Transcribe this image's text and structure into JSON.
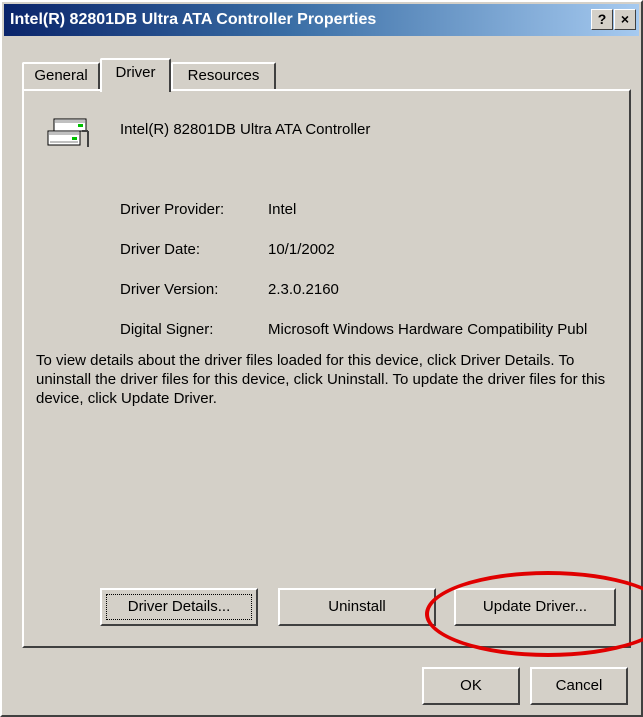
{
  "window": {
    "title": "Intel(R) 82801DB Ultra ATA Controller Properties",
    "help_button": "?",
    "close_button": "×"
  },
  "tabs": [
    {
      "label": "General"
    },
    {
      "label": "Driver",
      "selected": true
    },
    {
      "label": "Resources"
    }
  ],
  "device": {
    "name": "Intel(R) 82801DB Ultra ATA Controller",
    "icon": "ide-controller-icon"
  },
  "driver_info": [
    {
      "label": "Driver Provider:",
      "value": "Intel"
    },
    {
      "label": "Driver Date:",
      "value": "10/1/2002"
    },
    {
      "label": "Driver Version:",
      "value": "2.3.0.2160"
    },
    {
      "label": "Digital Signer:",
      "value": "Microsoft Windows Hardware Compatibility Publ"
    }
  ],
  "description": "To view details about the driver files loaded for this device, click Driver Details. To uninstall the driver files for this device, click Uninstall. To update the driver files for this device, click Update Driver.",
  "buttons": {
    "driver_details": "Driver Details...",
    "uninstall": "Uninstall",
    "update_driver": "Update Driver...",
    "ok": "OK",
    "cancel": "Cancel"
  },
  "annotation": {
    "highlight_color": "#e00000",
    "highlighted": "update_driver"
  }
}
